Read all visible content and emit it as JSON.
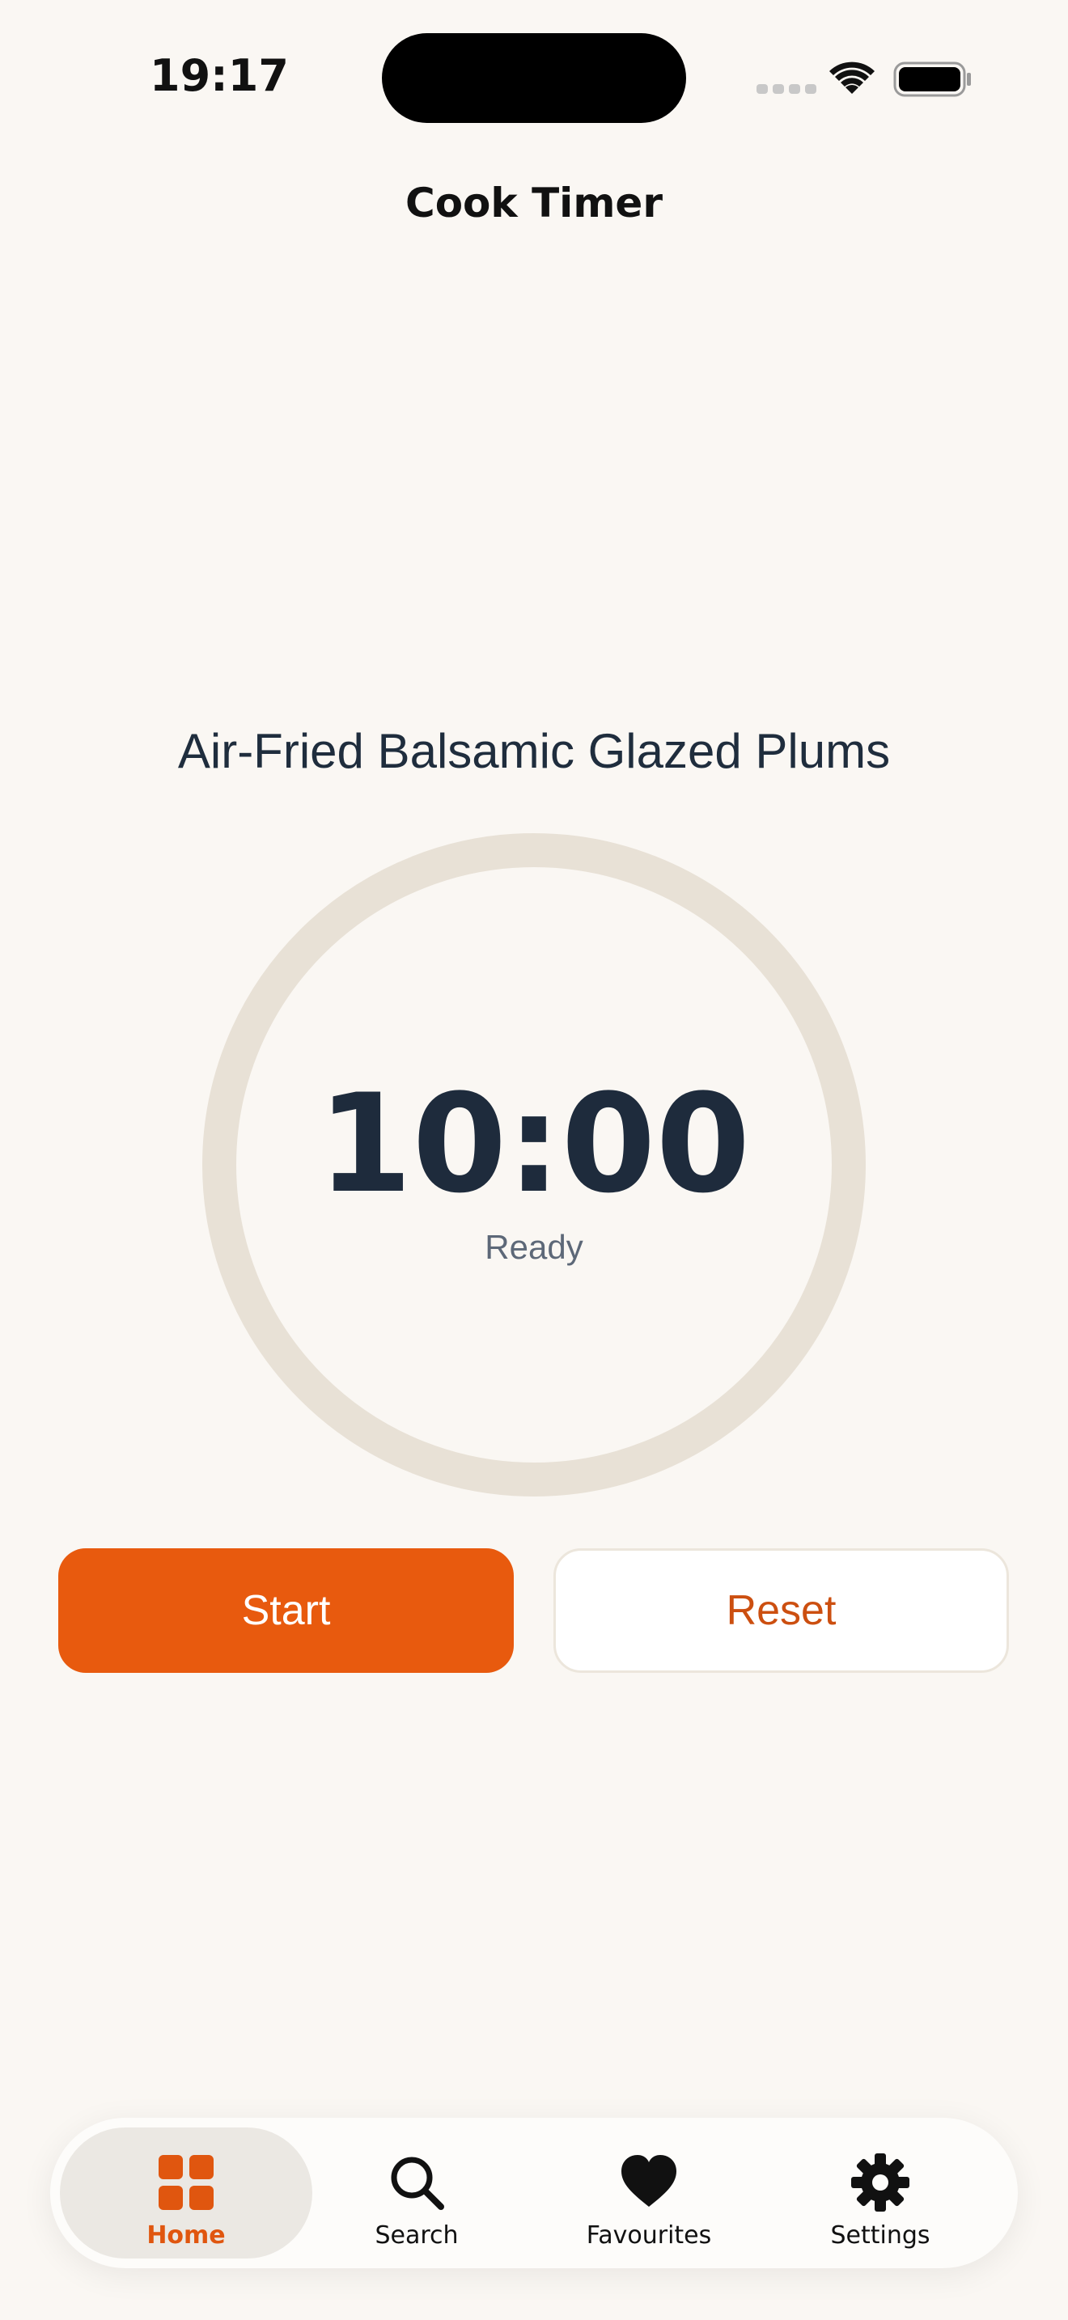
{
  "status_bar": {
    "time": "19:17"
  },
  "nav": {
    "title": "Cook Timer"
  },
  "recipe": {
    "name": "Air-Fried Balsamic Glazed Plums"
  },
  "timer": {
    "remaining": "10:00",
    "status": "Ready",
    "progress": 0
  },
  "actions": {
    "start_label": "Start",
    "reset_label": "Reset"
  },
  "tabs": [
    {
      "label": "Home",
      "icon": "grid-icon",
      "active": true
    },
    {
      "label": "Search",
      "icon": "search-icon",
      "active": false
    },
    {
      "label": "Favourites",
      "icon": "heart-icon",
      "active": false
    },
    {
      "label": "Settings",
      "icon": "gear-icon",
      "active": false
    }
  ],
  "colors": {
    "accent": "#e85a0e",
    "background": "#faf7f3",
    "ring": "#e8e1d6",
    "text_dark": "#1e2b3c"
  }
}
